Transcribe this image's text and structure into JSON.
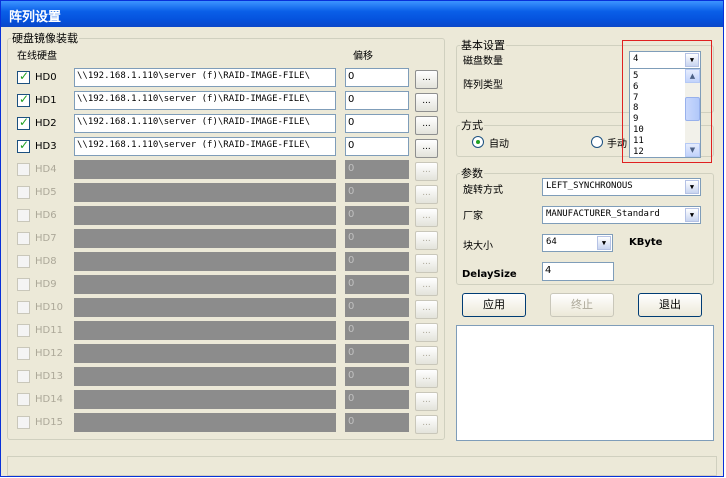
{
  "window": {
    "title": "阵列设置"
  },
  "mirror_panel": {
    "legend": "硬盘镜像装载",
    "col_online": "在线硬盘",
    "col_offset": "偏移",
    "disks": [
      {
        "name": "HD0",
        "checked": true,
        "enabled": true,
        "path": "\\\\192.168.1.110\\server (f)\\RAID-IMAGE-FILE\\",
        "offset": "0"
      },
      {
        "name": "HD1",
        "checked": true,
        "enabled": true,
        "path": "\\\\192.168.1.110\\server (f)\\RAID-IMAGE-FILE\\",
        "offset": "0"
      },
      {
        "name": "HD2",
        "checked": true,
        "enabled": true,
        "path": "\\\\192.168.1.110\\server (f)\\RAID-IMAGE-FILE\\",
        "offset": "0"
      },
      {
        "name": "HD3",
        "checked": true,
        "enabled": true,
        "path": "\\\\192.168.1.110\\server (f)\\RAID-IMAGE-FILE\\",
        "offset": "0"
      },
      {
        "name": "HD4",
        "checked": false,
        "enabled": false,
        "path": "",
        "offset": "0"
      },
      {
        "name": "HD5",
        "checked": false,
        "enabled": false,
        "path": "",
        "offset": "0"
      },
      {
        "name": "HD6",
        "checked": false,
        "enabled": false,
        "path": "",
        "offset": "0"
      },
      {
        "name": "HD7",
        "checked": false,
        "enabled": false,
        "path": "",
        "offset": "0"
      },
      {
        "name": "HD8",
        "checked": false,
        "enabled": false,
        "path": "",
        "offset": "0"
      },
      {
        "name": "HD9",
        "checked": false,
        "enabled": false,
        "path": "",
        "offset": "0"
      },
      {
        "name": "HD10",
        "checked": false,
        "enabled": false,
        "path": "",
        "offset": "0"
      },
      {
        "name": "HD11",
        "checked": false,
        "enabled": false,
        "path": "",
        "offset": "0"
      },
      {
        "name": "HD12",
        "checked": false,
        "enabled": false,
        "path": "",
        "offset": "0"
      },
      {
        "name": "HD13",
        "checked": false,
        "enabled": false,
        "path": "",
        "offset": "0"
      },
      {
        "name": "HD14",
        "checked": false,
        "enabled": false,
        "path": "",
        "offset": "0"
      },
      {
        "name": "HD15",
        "checked": false,
        "enabled": false,
        "path": "",
        "offset": "0"
      }
    ],
    "browse_label": "..."
  },
  "basic": {
    "legend": "基本设置",
    "disk_count_label": "磁盘数量",
    "disk_count_value": "4",
    "array_type_label": "阵列类型",
    "dropdown_options": [
      "5",
      "6",
      "7",
      "8",
      "9",
      "10",
      "11",
      "12"
    ]
  },
  "mode": {
    "legend": "方式",
    "auto_label": "自动",
    "manual_label": "手动",
    "selected": "auto"
  },
  "params": {
    "legend": "参数",
    "rotation_label": "旋转方式",
    "rotation_value": "LEFT_SYNCHRONOUS",
    "vendor_label": "厂家",
    "vendor_value": "MANUFACTURER_Standard",
    "block_label": "块大小",
    "block_value": "64",
    "block_unit": "KByte",
    "delay_label": "DelaySize",
    "delay_value": "4"
  },
  "actions": {
    "apply_label": "应用",
    "stop_label": "终止",
    "exit_label": "退出"
  },
  "icons": {
    "checkmark": "checkmark-icon",
    "dropdown_arrow": "chevron-down-icon",
    "scroll_up": "chevron-up-icon",
    "scroll_down": "chevron-down-icon"
  }
}
